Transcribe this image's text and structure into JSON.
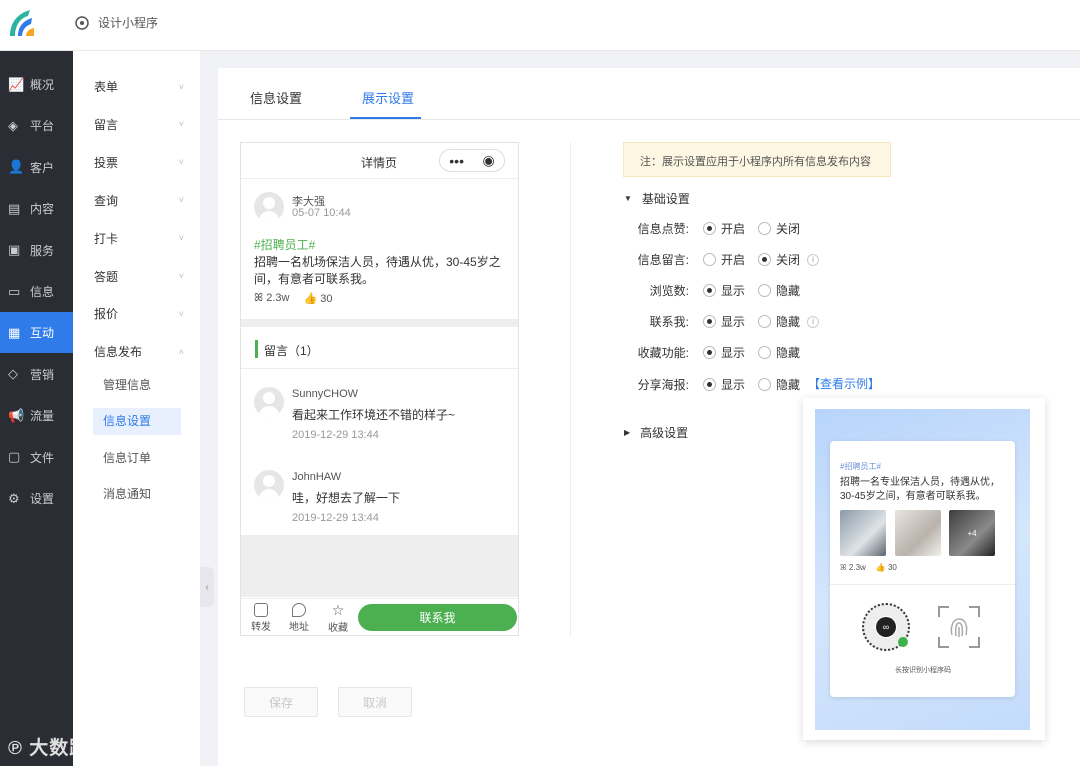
{
  "header": {
    "app_title": "设计小程序"
  },
  "rail": {
    "items": [
      {
        "label": "概况",
        "icon": "chart-icon"
      },
      {
        "label": "平台",
        "icon": "layers-icon"
      },
      {
        "label": "客户",
        "icon": "user-icon"
      },
      {
        "label": "内容",
        "icon": "document-icon"
      },
      {
        "label": "服务",
        "icon": "service-icon"
      },
      {
        "label": "信息",
        "icon": "message-icon"
      },
      {
        "label": "互动",
        "icon": "interaction-icon"
      },
      {
        "label": "营销",
        "icon": "tag-icon"
      },
      {
        "label": "流量",
        "icon": "megaphone-icon"
      },
      {
        "label": "文件",
        "icon": "folder-icon"
      },
      {
        "label": "设置",
        "icon": "gear-icon"
      }
    ],
    "active": "互动"
  },
  "submenu": {
    "items": [
      "表单",
      "留言",
      "投票",
      "查询",
      "打卡",
      "答题",
      "报价",
      "信息发布"
    ],
    "children": [
      "管理信息",
      "信息设置",
      "信息订单",
      "消息通知"
    ],
    "active_child": "信息设置"
  },
  "tabs": [
    "信息设置",
    "展示设置"
  ],
  "active_tab": "展示设置",
  "preview": {
    "page_title": "详情页",
    "author": "李大强",
    "post_time": "05-07 10:44",
    "hashtag": "#招聘员工#",
    "body": "招聘一名机场保洁人员，待遇从优，30-45岁之间，有意者可联系我。",
    "views": "2.3w",
    "likes": "30",
    "comments_title": "留言（1）",
    "comments": [
      {
        "name": "SunnyCHOW",
        "text": "看起来工作环境还不错的样子~",
        "time": "2019-12-29 13:44"
      },
      {
        "name": "JohnHAW",
        "text": "哇，好想去了解一下",
        "time": "2019-12-29 13:44"
      }
    ],
    "footer": {
      "share": "转发",
      "address": "地址",
      "favorite": "收藏",
      "contact": "联系我"
    }
  },
  "settings": {
    "note": "注：展示设置应用于小程序内所有信息发布内容",
    "basic_title": "基础设置",
    "advanced_title": "高级设置",
    "rows": [
      {
        "label": "信息点赞:",
        "opt1": "开启",
        "opt2": "关闭",
        "selected": 1
      },
      {
        "label": "信息留言:",
        "opt1": "开启",
        "opt2": "关闭",
        "selected": 2
      },
      {
        "label": "浏览数:",
        "opt1": "显示",
        "opt2": "隐藏",
        "selected": 1
      },
      {
        "label": "联系我:",
        "opt1": "显示",
        "opt2": "隐藏",
        "selected": 1
      },
      {
        "label": "收藏功能:",
        "opt1": "显示",
        "opt2": "隐藏",
        "selected": 1
      },
      {
        "label": "分享海报:",
        "opt1": "显示",
        "opt2": "隐藏",
        "selected": 1
      }
    ],
    "view_example": "【查看示例】",
    "save": "保存",
    "cancel": "取消"
  },
  "poster": {
    "hashtag": "#招聘员工#",
    "text": "招聘一名专业保洁人员，待遇从优，30-45岁之间，有意者可联系我。",
    "more_count": "+4",
    "views": "2.3w",
    "likes": "30",
    "caption": "长按识别小程序码"
  },
  "watermark": "大数跨境"
}
